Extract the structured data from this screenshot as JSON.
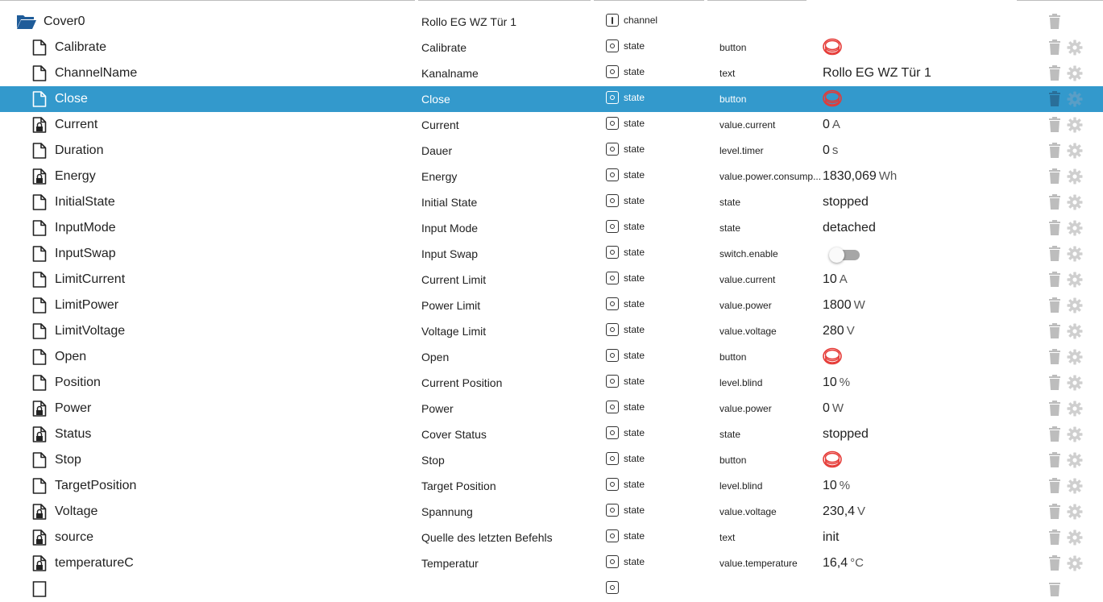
{
  "root": {
    "id": "Cover0",
    "name": "Rollo EG WZ Tür 1",
    "type": "channel",
    "icon": "folder-open-icon"
  },
  "colors": {
    "selected_bg": "#3399cc",
    "button_red": "#e53935",
    "icon_grey": "#bdbdbd"
  },
  "rows": [
    {
      "id": "Calibrate",
      "name": "Calibrate",
      "type": "state",
      "role": "button",
      "value": "",
      "unit": "",
      "kind": "button",
      "readonly": false,
      "selected": false
    },
    {
      "id": "ChannelName",
      "name": "Kanalname",
      "type": "state",
      "role": "text",
      "value": "Rollo EG WZ Tür 1",
      "unit": "",
      "kind": "text",
      "readonly": false,
      "selected": false
    },
    {
      "id": "Close",
      "name": "Close",
      "type": "state",
      "role": "button",
      "value": "",
      "unit": "",
      "kind": "button",
      "readonly": false,
      "selected": true
    },
    {
      "id": "Current",
      "name": "Current",
      "type": "state",
      "role": "value.current",
      "value": "0",
      "unit": "A",
      "kind": "text",
      "readonly": true,
      "selected": false
    },
    {
      "id": "Duration",
      "name": "Dauer",
      "type": "state",
      "role": "level.timer",
      "value": "0",
      "unit": "s",
      "kind": "text",
      "readonly": false,
      "selected": false
    },
    {
      "id": "Energy",
      "name": "Energy",
      "type": "state",
      "role": "value.power.consump...",
      "value": "1830,069",
      "unit": "Wh",
      "kind": "text",
      "readonly": true,
      "selected": false
    },
    {
      "id": "InitialState",
      "name": "Initial State",
      "type": "state",
      "role": "state",
      "value": "stopped",
      "unit": "",
      "kind": "text",
      "readonly": false,
      "selected": false
    },
    {
      "id": "InputMode",
      "name": "Input Mode",
      "type": "state",
      "role": "state",
      "value": "detached",
      "unit": "",
      "kind": "text",
      "readonly": false,
      "selected": false
    },
    {
      "id": "InputSwap",
      "name": "Input Swap",
      "type": "state",
      "role": "switch.enable",
      "value": "",
      "unit": "",
      "kind": "switch",
      "switch_on": false,
      "readonly": false,
      "selected": false
    },
    {
      "id": "LimitCurrent",
      "name": "Current Limit",
      "type": "state",
      "role": "value.current",
      "value": "10",
      "unit": "A",
      "kind": "text",
      "readonly": false,
      "selected": false
    },
    {
      "id": "LimitPower",
      "name": "Power Limit",
      "type": "state",
      "role": "value.power",
      "value": "1800",
      "unit": "W",
      "kind": "text",
      "readonly": false,
      "selected": false
    },
    {
      "id": "LimitVoltage",
      "name": "Voltage Limit",
      "type": "state",
      "role": "value.voltage",
      "value": "280",
      "unit": "V",
      "kind": "text",
      "readonly": false,
      "selected": false
    },
    {
      "id": "Open",
      "name": "Open",
      "type": "state",
      "role": "button",
      "value": "",
      "unit": "",
      "kind": "button",
      "readonly": false,
      "selected": false
    },
    {
      "id": "Position",
      "name": "Current Position",
      "type": "state",
      "role": "level.blind",
      "value": "10",
      "unit": "%",
      "kind": "text",
      "readonly": false,
      "selected": false
    },
    {
      "id": "Power",
      "name": "Power",
      "type": "state",
      "role": "value.power",
      "value": "0",
      "unit": "W",
      "kind": "text",
      "readonly": true,
      "selected": false
    },
    {
      "id": "Status",
      "name": "Cover Status",
      "type": "state",
      "role": "state",
      "value": "stopped",
      "unit": "",
      "kind": "text",
      "readonly": true,
      "selected": false
    },
    {
      "id": "Stop",
      "name": "Stop",
      "type": "state",
      "role": "button",
      "value": "",
      "unit": "",
      "kind": "button",
      "readonly": false,
      "selected": false
    },
    {
      "id": "TargetPosition",
      "name": "Target Position",
      "type": "state",
      "role": "level.blind",
      "value": "10",
      "unit": "%",
      "kind": "text",
      "readonly": false,
      "selected": false
    },
    {
      "id": "Voltage",
      "name": "Spannung",
      "type": "state",
      "role": "value.voltage",
      "value": "230,4",
      "unit": "V",
      "kind": "text",
      "readonly": true,
      "selected": false
    },
    {
      "id": "source",
      "name": "Quelle des letzten Befehls",
      "type": "state",
      "role": "text",
      "value": "init",
      "unit": "",
      "kind": "text",
      "readonly": true,
      "selected": false
    },
    {
      "id": "temperatureC",
      "name": "Temperatur",
      "type": "state",
      "role": "value.temperature",
      "value": "16,4",
      "unit": "°C",
      "kind": "text",
      "readonly": true,
      "selected": false
    }
  ]
}
